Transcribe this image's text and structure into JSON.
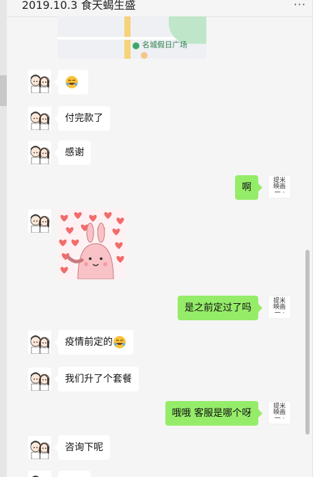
{
  "header": {
    "title": "2019.10.3 食天蝎生盛",
    "more": "···"
  },
  "map": {
    "label": "名城假日广场"
  },
  "messages": [
    {
      "side": "in",
      "text": ""
    },
    {
      "side": "in",
      "text": "付完款了"
    },
    {
      "side": "in",
      "text": "感谢"
    },
    {
      "side": "out",
      "text": "啊"
    },
    {
      "side": "in",
      "text": ""
    },
    {
      "side": "out",
      "text": "是之前定过了吗"
    },
    {
      "side": "in",
      "text": "疫情前定的"
    },
    {
      "side": "in",
      "text": "我们升了个套餐"
    },
    {
      "side": "out",
      "text": "哦哦 客服是哪个呀"
    },
    {
      "side": "in",
      "text": "咨询下呢"
    }
  ],
  "logo": {
    "line1": "提米",
    "line2": "映画",
    "line3": "一 ·"
  },
  "icons": {
    "emoji": "rofl-emoji-icon",
    "more": "more-dots-icon"
  }
}
